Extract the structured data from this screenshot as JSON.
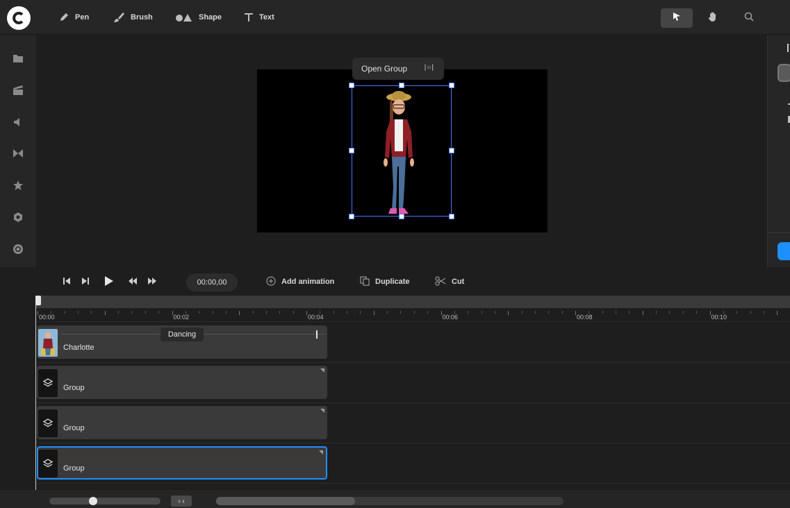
{
  "toolbar": {
    "tools": [
      {
        "label": "Pen",
        "icon": "pen-icon"
      },
      {
        "label": "Brush",
        "icon": "brush-icon"
      },
      {
        "label": "Shape",
        "icon": "shape-icon"
      },
      {
        "label": "Text",
        "icon": "text-icon"
      }
    ],
    "right_tools": [
      "pointer-icon",
      "hand-icon",
      "search-icon"
    ]
  },
  "sidebar": {
    "icons": [
      "folder-icon",
      "media-icon",
      "audio-icon",
      "transition-icon",
      "star-icon",
      "settings-icon",
      "record-icon"
    ]
  },
  "canvas": {
    "popup_label": "Open Group",
    "popup_action": "|○|"
  },
  "controls": {
    "time": "00:00,00",
    "add_animation": "Add animation",
    "duplicate": "Duplicate",
    "cut": "Cut"
  },
  "timeline": {
    "ruler_labels": [
      "00:00",
      "00:02",
      "00:04",
      "00:06",
      "00:08",
      "00:10"
    ],
    "tracks": [
      {
        "name": "Charlotte",
        "animation": "Dancing",
        "selected": false
      },
      {
        "name": "Group",
        "selected": false
      },
      {
        "name": "Group",
        "selected": false
      },
      {
        "name": "Group",
        "selected": true
      }
    ]
  },
  "colors": {
    "accent": "#1e8fff",
    "selection": "#4a78ff"
  }
}
